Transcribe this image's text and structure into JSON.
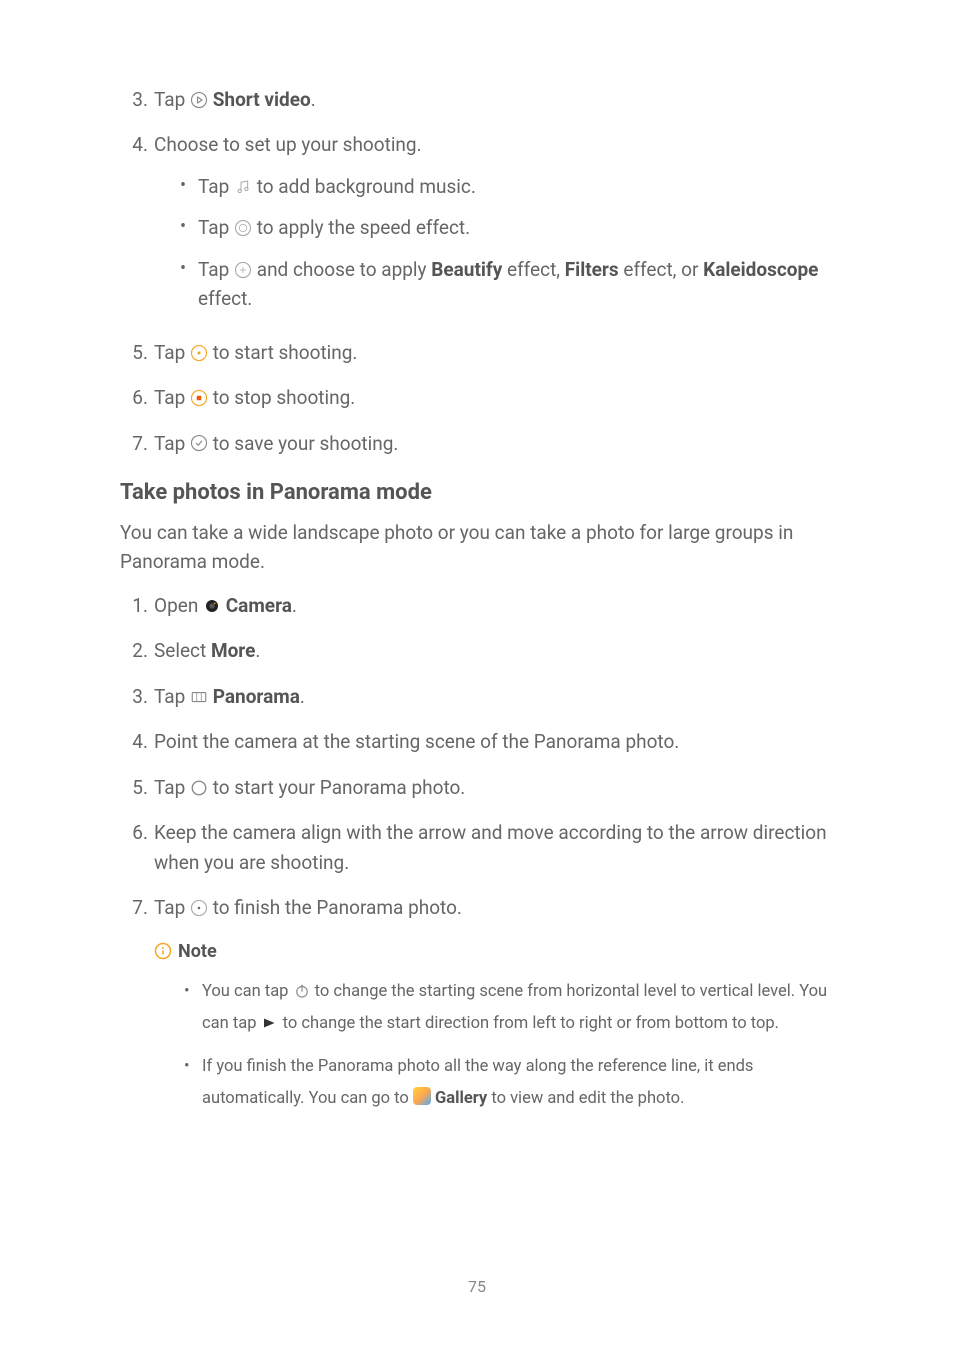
{
  "steps_a": [
    {
      "num": "3.",
      "pre": "Tap ",
      "bold": "Short video",
      "post": "."
    },
    {
      "num": "4.",
      "text": "Choose to set up your shooting."
    },
    {
      "num": "5.",
      "pre": "Tap ",
      "post": " to start shooting."
    },
    {
      "num": "6.",
      "pre": "Tap ",
      "post": " to stop shooting."
    },
    {
      "num": "7.",
      "pre": "Tap ",
      "post": " to save your shooting."
    }
  ],
  "sub4": {
    "a": {
      "pre": "Tap ",
      "post": " to add background music."
    },
    "b": {
      "pre": "Tap ",
      "post": " to apply the speed effect."
    },
    "c": {
      "pre": "Tap ",
      "mid1": " and choose to apply ",
      "b1": "Beautify",
      "mid2": " effect, ",
      "b2": "Filters",
      "mid3": " effect, or ",
      "b3": "Kaleidoscope",
      "post": " effect."
    }
  },
  "heading": "Take photos in Panorama mode",
  "intro": "You can take a wide landscape photo or you can take a photo for large groups in Panorama mode.",
  "steps_b": {
    "1": {
      "num": "1.",
      "pre": "Open ",
      "bold": "Camera",
      "post": "."
    },
    "2": {
      "num": "2.",
      "pre": "Select ",
      "bold": "More",
      "post": "."
    },
    "3": {
      "num": "3.",
      "pre": "Tap ",
      "bold": "Panorama",
      "post": "."
    },
    "4": {
      "num": "4.",
      "text": "Point the camera at the starting scene of the Panorama photo."
    },
    "5": {
      "num": "5.",
      "pre": "Tap ",
      "post": " to start your Panorama photo."
    },
    "6": {
      "num": "6.",
      "text": "Keep the camera align with the arrow and move according to the arrow direction when you are shooting."
    },
    "7": {
      "num": "7.",
      "pre": "Tap ",
      "post": " to finish the Panorama photo."
    }
  },
  "note": {
    "label": "Note",
    "n1": {
      "pre": "You can tap ",
      "mid": " to change the starting scene from horizontal level to vertical level. You can tap ",
      "post": " to change the start direction from left to right or from bottom to top."
    },
    "n2": {
      "pre": "If you finish the Panorama photo all the way along the reference line, it ends automatically. You can go to ",
      "bold": "Gallery",
      "post": " to view and edit the photo."
    }
  },
  "pageNum": "75"
}
